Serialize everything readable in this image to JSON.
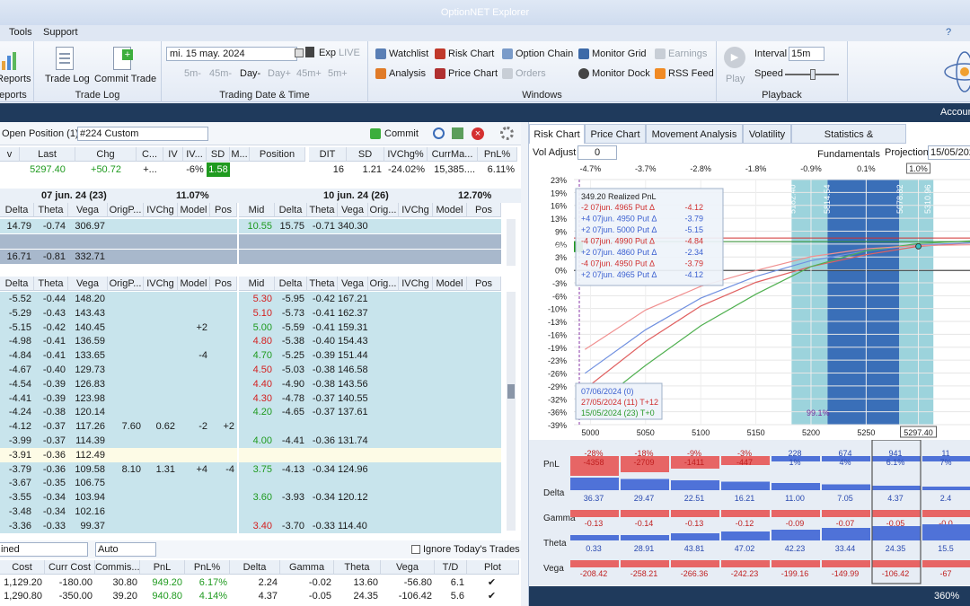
{
  "app": {
    "title": "OptionNET Explorer"
  },
  "menu": {
    "tools": "Tools",
    "support": "Support",
    "help": "?"
  },
  "ribbon": {
    "reports_btn": "Reports",
    "reports_group": "Reports",
    "trade_log_btn": "Trade Log",
    "commit_trade_btn": "Commit Trade",
    "trade_log_group": "Trade Log",
    "date_value": "mi. 15 may. 2024",
    "exp_label": "Exp",
    "live_label": "LIVE",
    "steps": [
      "5m-",
      "45m-",
      "Day-",
      "Day+",
      "45m+",
      "5m+"
    ],
    "date_group": "Trading Date & Time",
    "watchlist": "Watchlist",
    "risk_chart": "Risk Chart",
    "option_chain": "Option Chain",
    "monitor_grid": "Monitor Grid",
    "earnings": "Earnings",
    "analysis": "Analysis",
    "price_chart": "Price Chart",
    "orders": "Orders",
    "monitor_dock": "Monitor Dock",
    "rss_feed": "RSS Feed",
    "windows_group": "Windows",
    "play": "Play",
    "interval_label": "Interval",
    "interval_value": "15m",
    "speed_label": "Speed",
    "playback_group": "Playback"
  },
  "statusbar": {
    "account": "Accoun"
  },
  "position": {
    "label": "Open Position (1)",
    "selector": "#224 Custom",
    "commit": "Commit",
    "headers": [
      "v",
      "Last",
      "Chg",
      "C...",
      "IV",
      "IV...",
      "SD",
      "M...",
      "Position"
    ],
    "values": [
      "",
      "5297.40",
      "+50.72",
      "+...",
      "",
      "-6%",
      "1.58",
      "",
      ""
    ],
    "right_headers": [
      "DIT",
      "SD",
      "IVChg%",
      "CurrMa...",
      "PnL%"
    ],
    "right_values": [
      "16",
      "1.21",
      "-24.02%",
      "15,385....",
      "6.11%"
    ]
  },
  "expiries": {
    "left": {
      "name": "07 jun. 24 (23)",
      "pct": "11.07%"
    },
    "right": {
      "name": "10 jun. 24 (26)",
      "pct": "12.70%"
    }
  },
  "chain_headers_left": [
    "Delta",
    "Theta",
    "Vega",
    "OrigP...",
    "IVChg",
    "Model",
    "Pos"
  ],
  "chain_headers_right": [
    "Mid",
    "Delta",
    "Theta",
    "Vega",
    "Orig...",
    "IVChg",
    "Model",
    "Pos"
  ],
  "top_rows_left": [
    [
      "14.79",
      "-0.74",
      "306.97",
      "",
      "",
      "",
      ""
    ],
    [
      "",
      "",
      "",
      "",
      "",
      "",
      ""
    ],
    [
      "16.71",
      "-0.81",
      "332.71",
      "",
      "",
      "",
      ""
    ]
  ],
  "top_rows_right": [
    [
      "10.55",
      "15.75",
      "-0.71",
      "340.30",
      "",
      "",
      "",
      ""
    ],
    [
      "",
      "",
      "",
      "",
      "",
      "",
      "",
      ""
    ],
    [
      "",
      "",
      "",
      "",
      "",
      "",
      "",
      ""
    ]
  ],
  "lower_left": [
    [
      "-5.52",
      "-0.44",
      "148.20",
      "",
      "",
      "",
      ""
    ],
    [
      "-5.29",
      "-0.43",
      "143.43",
      "",
      "",
      "",
      ""
    ],
    [
      "-5.15",
      "-0.42",
      "140.45",
      "",
      "",
      "+2",
      ""
    ],
    [
      "-4.98",
      "-0.41",
      "136.59",
      "",
      "",
      "",
      ""
    ],
    [
      "-4.84",
      "-0.41",
      "133.65",
      "",
      "",
      "-4",
      ""
    ],
    [
      "-4.67",
      "-0.40",
      "129.73",
      "",
      "",
      "",
      ""
    ],
    [
      "-4.54",
      "-0.39",
      "126.83",
      "",
      "",
      "",
      ""
    ],
    [
      "-4.41",
      "-0.39",
      "123.98",
      "",
      "",
      "",
      ""
    ],
    [
      "-4.24",
      "-0.38",
      "120.14",
      "",
      "",
      "",
      ""
    ],
    [
      "-4.12",
      "-0.37",
      "117.26",
      "7.60",
      "0.62",
      "-2",
      "+2"
    ],
    [
      "-3.99",
      "-0.37",
      "114.39",
      "",
      "",
      "",
      ""
    ],
    [
      "-3.91",
      "-0.36",
      "112.49",
      "",
      "",
      "",
      ""
    ],
    [
      "-3.79",
      "-0.36",
      "109.58",
      "8.10",
      "1.31",
      "+4",
      "-4"
    ],
    [
      "-3.67",
      "-0.35",
      "106.75",
      "",
      "",
      "",
      ""
    ],
    [
      "-3.55",
      "-0.34",
      "103.94",
      "",
      "",
      "",
      ""
    ],
    [
      "-3.48",
      "-0.34",
      "102.16",
      "",
      "",
      "",
      ""
    ],
    [
      "-3.36",
      "-0.33",
      "99.37",
      "",
      "",
      "",
      ""
    ]
  ],
  "lower_right": [
    [
      "5.30",
      "-5.95",
      "-0.42",
      "167.21"
    ],
    [
      "5.10",
      "-5.73",
      "-0.41",
      "162.37"
    ],
    [
      "5.00",
      "-5.59",
      "-0.41",
      "159.31"
    ],
    [
      "4.80",
      "-5.38",
      "-0.40",
      "154.43"
    ],
    [
      "4.70",
      "-5.25",
      "-0.39",
      "151.44"
    ],
    [
      "4.50",
      "-5.03",
      "-0.38",
      "146.58"
    ],
    [
      "4.40",
      "-4.90",
      "-0.38",
      "143.56"
    ],
    [
      "4.30",
      "-4.78",
      "-0.37",
      "140.55"
    ],
    [
      "4.20",
      "-4.65",
      "-0.37",
      "137.61"
    ],
    [
      "",
      "",
      "",
      ""
    ],
    [
      "4.00",
      "-4.41",
      "-0.36",
      "131.74"
    ],
    [
      "",
      "",
      "",
      ""
    ],
    [
      "3.75",
      "-4.13",
      "-0.34",
      "124.96"
    ],
    [
      "",
      "",
      "",
      ""
    ],
    [
      "3.60",
      "-3.93",
      "-0.34",
      "120.12"
    ],
    [
      "",
      "",
      "",
      ""
    ],
    [
      "3.40",
      "-3.70",
      "-0.33",
      "114.40"
    ]
  ],
  "lower_right_mid_color": [
    "red",
    "red",
    "green",
    "red",
    "green",
    "red",
    "red",
    "red",
    "green",
    "",
    "green",
    "",
    "green",
    "",
    "green",
    "",
    "red"
  ],
  "bottom": {
    "combo": "ined",
    "auto": "Auto",
    "ignore": "Ignore Today's Trades",
    "headers": [
      "Cost",
      "Curr Cost",
      "Commis...",
      "PnL",
      "PnL%",
      "Delta",
      "Gamma",
      "Theta",
      "Vega",
      "T/D",
      "Plot"
    ],
    "rows": [
      [
        "1,129.20",
        "-180.00",
        "30.80",
        "949.20",
        "6.17%",
        "2.24",
        "-0.02",
        "13.60",
        "-56.80",
        "6.1",
        "✔"
      ],
      [
        "1,290.80",
        "-350.00",
        "39.20",
        "940.80",
        "4.14%",
        "4.37",
        "-0.05",
        "24.35",
        "-106.42",
        "5.6",
        "✔"
      ]
    ]
  },
  "right": {
    "tabs": [
      "Risk Chart",
      "Price Chart",
      "Movement Analysis",
      "Volatility",
      "Statistics & Fundamentals"
    ],
    "vol_adjust": "Vol Adjust",
    "vol_value": "0",
    "projection": "Projection",
    "proj_value": "15/05/202",
    "top_pcts": [
      "-4.7%",
      "-3.7%",
      "-2.8%",
      "-1.8%",
      "-0.9%",
      "0.1%",
      "1.0%",
      "2.0"
    ],
    "y_ticks": [
      "23%",
      "19%",
      "16%",
      "13%",
      "9%",
      "6%",
      "3%",
      "0%",
      "-3%",
      "-6%",
      "-10%",
      "-13%",
      "-16%",
      "-19%",
      "-23%",
      "-26%",
      "-29%",
      "-32%",
      "-36%",
      "-39%"
    ],
    "x_ticks": [
      "5000",
      "5050",
      "5100",
      "5150",
      "5200",
      "5250",
      "5297.40",
      "535"
    ],
    "legend_title": "349.20 Realized PnL",
    "legend": [
      [
        "-2 07jun. 4965 Put Δ",
        "-4.12"
      ],
      [
        "+4 07jun. 4950 Put Δ",
        "-3.79"
      ],
      [
        "+2 07jun. 5000 Put Δ",
        "-5.15"
      ],
      [
        "-4 07jun. 4990 Put Δ",
        "-4.84"
      ],
      [
        "+2 07jun. 4860 Put Δ",
        "-2.34"
      ],
      [
        "-4 07jun. 4950 Put Δ",
        "-3.79"
      ],
      [
        "+2 07jun. 4965 Put Δ",
        "-4.12"
      ]
    ],
    "dates": [
      "07/06/2024 (0)",
      "27/05/2024 (11) T+12",
      "15/05/2024 (23) T+0"
    ],
    "strikes": [
      "5182.40",
      "5814.54",
      "5078.82",
      "5310.96"
    ],
    "prob": "99.1%",
    "current_y": "6%",
    "vline_label": "4994.04",
    "greek_rows": [
      {
        "name": "PnL",
        "cells": [
          [
            "-28%",
            "-4358"
          ],
          [
            "-18%",
            "-2709"
          ],
          [
            "-9%",
            "-1411"
          ],
          [
            "-3%",
            "-447"
          ],
          [
            "228",
            "1%"
          ],
          [
            "674",
            "4%"
          ],
          [
            "941",
            "6.1%"
          ],
          [
            "11",
            "7%"
          ]
        ]
      },
      {
        "name": "Delta",
        "cells": [
          "36.37",
          "29.47",
          "22.51",
          "16.21",
          "11.00",
          "7.05",
          "4.37",
          "2.4"
        ]
      },
      {
        "name": "Gamma",
        "cells": [
          "-0.13",
          "-0.14",
          "-0.13",
          "-0.12",
          "-0.09",
          "-0.07",
          "-0.05",
          "-0.0"
        ]
      },
      {
        "name": "Theta",
        "cells": [
          "0.33",
          "28.91",
          "43.81",
          "47.02",
          "42.23",
          "33.44",
          "24.35",
          "15.5"
        ]
      },
      {
        "name": "Vega",
        "cells": [
          "-208.42",
          "-258.21",
          "-266.36",
          "-242.23",
          "-199.16",
          "-149.99",
          "-106.42",
          "-67"
        ]
      }
    ],
    "zoom": "360%"
  }
}
